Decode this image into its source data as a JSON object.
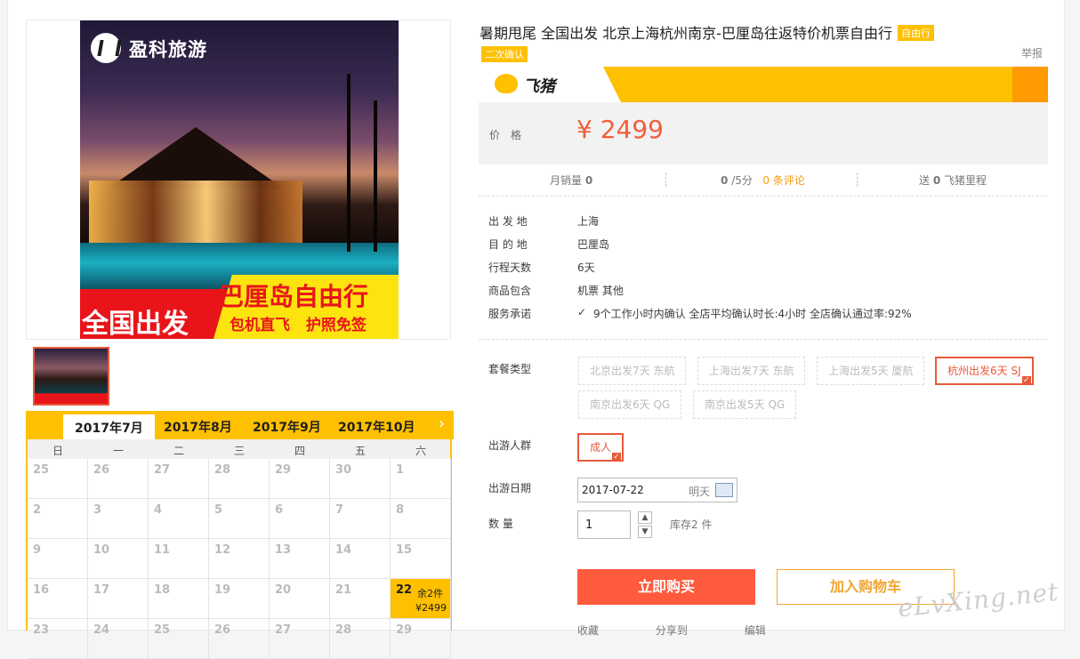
{
  "brand": {
    "name": "盈科旅游"
  },
  "banner": {
    "left_text": "全国出发",
    "big_text": "巴厘岛自由行",
    "sub_text": "包机直飞 护照免签"
  },
  "calendar": {
    "months": [
      "2017年7月",
      "2017年8月",
      "2017年9月",
      "2017年10月"
    ],
    "next_icon": "›",
    "weekdays": [
      "日",
      "一",
      "二",
      "三",
      "四",
      "五",
      "六"
    ],
    "rows": [
      [
        "25",
        "26",
        "27",
        "28",
        "29",
        "30",
        "1"
      ],
      [
        "2",
        "3",
        "4",
        "5",
        "6",
        "7",
        "8"
      ],
      [
        "9",
        "10",
        "11",
        "12",
        "13",
        "14",
        "15"
      ],
      [
        "16",
        "17",
        "18",
        "19",
        "20",
        "21",
        "22"
      ],
      [
        "23",
        "24",
        "25",
        "26",
        "27",
        "28",
        "29"
      ]
    ],
    "selected": {
      "day": "22",
      "stock": "余2件",
      "price": "¥2499"
    }
  },
  "product": {
    "title": "暑期甩尾 全国出发 北京上海杭州南京-巴厘岛往返特价机票自由行",
    "tag": "自由行",
    "tag2": "二次确认",
    "report": "举报",
    "platform": "飞猪",
    "price_label": "价格",
    "price": "¥ 2499",
    "stats": {
      "monthly_label": "月销量",
      "monthly": "0",
      "score": "0",
      "score_unit": "/5分",
      "reviews": "0 条评论",
      "miles_pre": "送",
      "miles": "0",
      "miles_post": "飞猪里程"
    }
  },
  "info": [
    {
      "k": "出 发 地",
      "v": "上海"
    },
    {
      "k": "目 的 地",
      "v": "巴厘岛"
    },
    {
      "k": "行程天数",
      "v": "6天"
    },
    {
      "k": "商品包含",
      "v": "机票  其他"
    },
    {
      "k": "服务承诺",
      "v": "9个工作小时内确认    全店平均确认时长:4小时    全店确认通过率:92%"
    }
  ],
  "options": {
    "package_label": "套餐类型",
    "packages": [
      "北京出发7天 东航",
      "上海出发7天 东航",
      "上海出发5天 厦航",
      "杭州出发6天 SJ",
      "南京出发6天 QG",
      "南京出发5天 QG"
    ],
    "people_label": "出游人群",
    "people": "成人",
    "date_label": "出游日期",
    "date_value": "2017-07-22",
    "date_hint": "明天",
    "qty_label": "数    量",
    "qty_value": "1",
    "stock_text": "库存2 件"
  },
  "actions": {
    "buy": "立即购买",
    "cart": "加入购物车",
    "fav": "收藏",
    "share": "分享到",
    "edit": "编辑"
  },
  "watermark": "eLvXing.net"
}
